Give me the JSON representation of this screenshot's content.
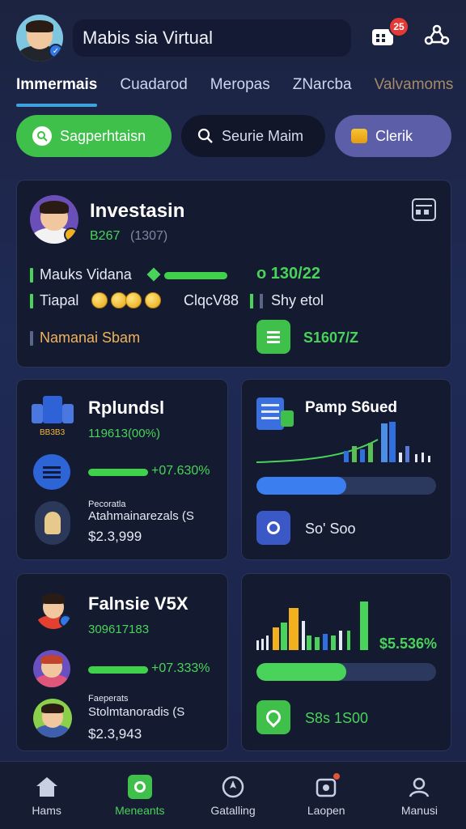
{
  "header": {
    "title": "Mabis sia Virtual",
    "notif_count": "25"
  },
  "tabs": [
    {
      "label": "Immermais",
      "active": true
    },
    {
      "label": "Cuadarod"
    },
    {
      "label": "Meropas"
    },
    {
      "label": "ZNarcba"
    },
    {
      "label": "Valvamoms"
    }
  ],
  "chips": {
    "primary": "Sagperhtaisn",
    "search_placeholder": "Seurie Maim",
    "check": "Clerik"
  },
  "invest_card": {
    "title": "Investasin",
    "subtitle_a": "B267",
    "subtitle_b": "(1307)",
    "row1_label": "Mauks Vidana",
    "row1_value": "o 130/22",
    "row2_label": "Tiapal",
    "row2_mid": "ClqcV88",
    "row2_right": "Shy etol",
    "row3_label": "Namanai Sbam",
    "row3_value": "S1607/Z"
  },
  "card_a": {
    "title": "Rplundsl",
    "subtitle": "119613(00%)",
    "icon_label": "BB3B3",
    "bar_value": "+07.630%",
    "bar_fraction": 0.85,
    "small_label": "Pecoratla",
    "label2": "Atahmainarezals (S",
    "amount": "$2.3,999"
  },
  "card_b": {
    "title": "Pamp S6ued",
    "progress_fraction": 0.5,
    "footer": "So' Soo"
  },
  "card_c": {
    "title": "Falnsie V5X",
    "subtitle": "309617183",
    "bar_value": "+07.333%",
    "bar_fraction": 0.83,
    "small_label": "Faeperats",
    "label2": "Stolmtanoradis (S",
    "amount": "$2.3,943"
  },
  "card_d": {
    "amount": "$5.536%",
    "progress_fraction": 0.5,
    "footer": "S8s 1S00"
  },
  "nav": [
    {
      "label": "Hams",
      "icon": "home-icon"
    },
    {
      "label": "Meneants",
      "icon": "chat-icon",
      "active": true
    },
    {
      "label": "Gatalling",
      "icon": "compass-icon"
    },
    {
      "label": "Laopen",
      "icon": "gift-icon"
    },
    {
      "label": "Manusi",
      "icon": "user-icon"
    }
  ],
  "colors": {
    "accent_green": "#49d35a",
    "accent_blue": "#3a7ef0",
    "background": "#1c2340"
  }
}
